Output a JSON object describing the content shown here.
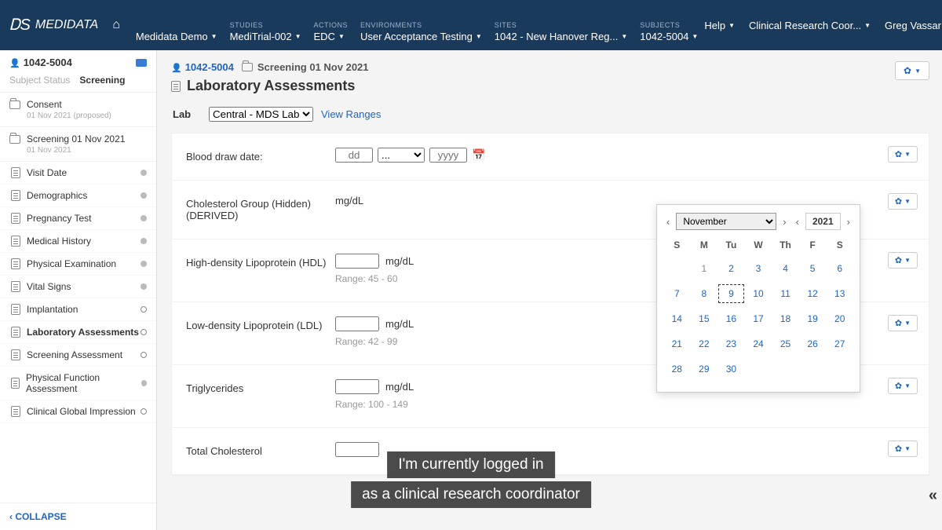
{
  "brand": "MEDIDATA",
  "nav": {
    "demo": "Medidata Demo",
    "studies_label": "STUDIES",
    "studies_value": "MediTrial-002",
    "actions_label": "ACTIONS",
    "actions_value": "EDC",
    "env_label": "ENVIRONMENTS",
    "env_value": "User Acceptance Testing",
    "sites_label": "SITES",
    "sites_value": "1042 - New Hanover Reg...",
    "subjects_label": "SUBJECTS",
    "subjects_value": "1042-5004",
    "help": "Help",
    "role": "Clinical Research Coor...",
    "user": "Greg Vassar (Admin)"
  },
  "sidebar": {
    "subject": "1042-5004",
    "tab_status": "Subject Status",
    "tab_screening": "Screening",
    "consent": "Consent",
    "consent_sub": "01 Nov 2021 (proposed)",
    "screening": "Screening 01 Nov 2021",
    "screening_sub": "01 Nov 2021",
    "items": [
      {
        "label": "Visit Date",
        "state": "dot"
      },
      {
        "label": "Demographics",
        "state": "dot"
      },
      {
        "label": "Pregnancy Test",
        "state": "dot"
      },
      {
        "label": "Medical History",
        "state": "dot"
      },
      {
        "label": "Physical Examination",
        "state": "dot"
      },
      {
        "label": "Vital Signs",
        "state": "dot"
      },
      {
        "label": "Implantation",
        "state": "open"
      },
      {
        "label": "Laboratory Assessments",
        "state": "open",
        "active": true
      },
      {
        "label": "Screening Assessment",
        "state": "open"
      },
      {
        "label": "Physical Function Assessment",
        "state": "dot"
      },
      {
        "label": "Clinical Global Impression",
        "state": "open"
      }
    ],
    "collapse": "COLLAPSE"
  },
  "crumbs": {
    "subject": "1042-5004",
    "folder": "Screening 01 Nov 2021"
  },
  "page_title": "Laboratory Assessments",
  "lab": {
    "label": "Lab",
    "value": "Central - MDS Lab",
    "view_ranges": "View Ranges"
  },
  "blood_draw": {
    "label": "Blood draw date:",
    "dd": "dd",
    "mm": "...",
    "yyyy": "yyyy"
  },
  "fields": [
    {
      "label": "Cholesterol Group (Hidden) (DERIVED)",
      "unit": "mg/dL",
      "range": "",
      "no_input": true
    },
    {
      "label": "High-density Lipoprotein (HDL)",
      "unit": "mg/dL",
      "range": "Range: 45 - 60"
    },
    {
      "label": "Low-density Lipoprotein (LDL)",
      "unit": "mg/dL",
      "range": "Range: 42 - 99"
    },
    {
      "label": "Triglycerides",
      "unit": "mg/dL",
      "range": "Range: 100 - 149"
    },
    {
      "label": "Total Cholesterol",
      "unit": "",
      "range": ""
    }
  ],
  "calendar": {
    "month": "November",
    "year": "2021",
    "dow": [
      "S",
      "M",
      "Tu",
      "W",
      "Th",
      "F",
      "S"
    ],
    "start_offset": 1,
    "days": 30,
    "today": 9
  },
  "caption": {
    "line1": "I'm currently logged in",
    "line2": "as a clinical research coordinator"
  }
}
